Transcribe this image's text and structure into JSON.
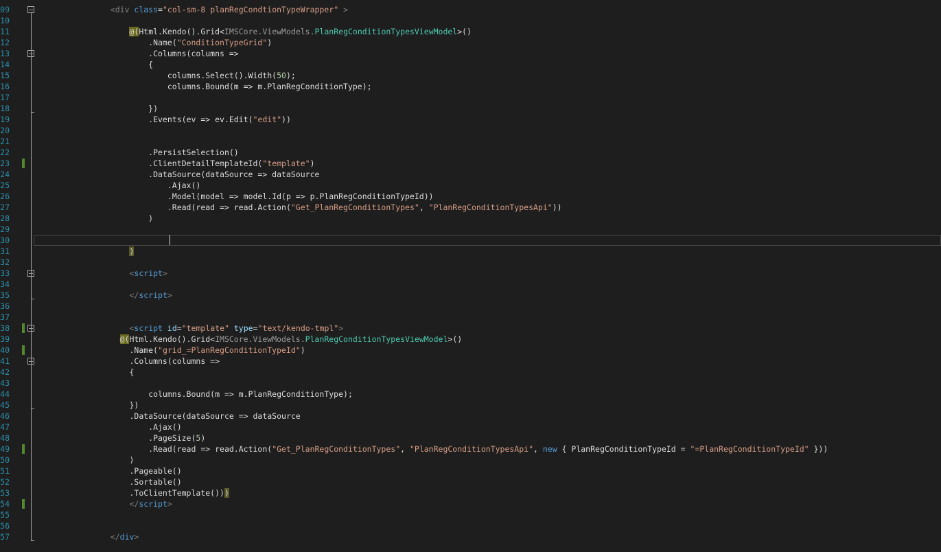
{
  "editor": {
    "colors": {
      "background": "#1e1e1e",
      "line_number": "#2b91af",
      "change_marker": "#52892e",
      "string": "#d69d85",
      "type": "#4ec9b0",
      "keyword": "#569cd6",
      "tag": "#808080"
    },
    "caret_line": "30",
    "lines": [
      {
        "n": "09",
        "fold": true,
        "tokens": [
          [
            "t",
            "                <div "
          ],
          [
            "kw",
            "class"
          ],
          [
            "p",
            "="
          ],
          [
            "s",
            "\"col-sm-8 planRegCondtionTypeWrapper\""
          ],
          [
            "t",
            " >"
          ]
        ]
      },
      {
        "n": "10",
        "tokens": []
      },
      {
        "n": "11",
        "tokens": [
          [
            "p",
            "                    "
          ],
          [
            "ref",
            "@("
          ],
          [
            "p",
            "Html.Kendo().Grid<"
          ],
          [
            "ns",
            "IMSCore.ViewModels."
          ],
          [
            "ty",
            "PlanRegConditionTypesViewModel"
          ],
          [
            "p",
            ">()"
          ]
        ]
      },
      {
        "n": "12",
        "tokens": [
          [
            "p",
            "                        .Name("
          ],
          [
            "s",
            "\"ConditionTypeGrid\""
          ],
          [
            "p",
            ")"
          ]
        ]
      },
      {
        "n": "13",
        "fold": true,
        "tokens": [
          [
            "p",
            "                        .Columns(columns =>"
          ]
        ]
      },
      {
        "n": "14",
        "tokens": [
          [
            "p",
            "                        {"
          ]
        ]
      },
      {
        "n": "15",
        "tokens": [
          [
            "p",
            "                            columns.Select().Width("
          ],
          [
            "num",
            "50"
          ],
          [
            "p",
            ");"
          ]
        ]
      },
      {
        "n": "16",
        "tokens": [
          [
            "p",
            "                            columns.Bound(m => m.PlanRegConditionType);"
          ]
        ]
      },
      {
        "n": "17",
        "tokens": []
      },
      {
        "n": "18",
        "tokens": [
          [
            "p",
            "                        })"
          ]
        ]
      },
      {
        "n": "19",
        "tokens": [
          [
            "p",
            "                        .Events(ev => ev.Edit("
          ],
          [
            "s",
            "\"edit\""
          ],
          [
            "p",
            "))"
          ]
        ]
      },
      {
        "n": "20",
        "tokens": []
      },
      {
        "n": "21",
        "tokens": []
      },
      {
        "n": "22",
        "tokens": [
          [
            "p",
            "                        .PersistSelection()"
          ]
        ]
      },
      {
        "n": "23",
        "chg": true,
        "tokens": [
          [
            "p",
            "                        .ClientDetailTemplateId("
          ],
          [
            "s",
            "\"template\""
          ],
          [
            "p",
            ")"
          ]
        ]
      },
      {
        "n": "24",
        "tokens": [
          [
            "p",
            "                        .DataSource(dataSource => dataSource"
          ]
        ]
      },
      {
        "n": "25",
        "tokens": [
          [
            "p",
            "                            .Ajax()"
          ]
        ]
      },
      {
        "n": "26",
        "tokens": [
          [
            "p",
            "                            .Model(model => model.Id(p => p.PlanRegConditionTypeId))"
          ]
        ]
      },
      {
        "n": "27",
        "tokens": [
          [
            "p",
            "                            .Read(read => read.Action("
          ],
          [
            "s",
            "\"Get_PlanRegConditionTypes\""
          ],
          [
            "p",
            ", "
          ],
          [
            "s",
            "\"PlanRegConditionTypesApi\""
          ],
          [
            "p",
            "))"
          ]
        ]
      },
      {
        "n": "28",
        "tokens": [
          [
            "p",
            "                        )"
          ]
        ]
      },
      {
        "n": "29",
        "tokens": []
      },
      {
        "n": "30",
        "tokens": []
      },
      {
        "n": "31",
        "tokens": [
          [
            "p",
            "                    "
          ],
          [
            "brk",
            ")"
          ]
        ]
      },
      {
        "n": "32",
        "tokens": []
      },
      {
        "n": "33",
        "fold": true,
        "tokens": [
          [
            "p",
            "                    "
          ],
          [
            "t",
            "<"
          ],
          [
            "kw",
            "script"
          ],
          [
            "t",
            ">"
          ]
        ]
      },
      {
        "n": "34",
        "tokens": []
      },
      {
        "n": "35",
        "tokens": [
          [
            "p",
            "                    "
          ],
          [
            "t",
            "</"
          ],
          [
            "kw",
            "script"
          ],
          [
            "t",
            ">"
          ]
        ]
      },
      {
        "n": "36",
        "tokens": []
      },
      {
        "n": "37",
        "tokens": []
      },
      {
        "n": "38",
        "chg": true,
        "fold": true,
        "tokens": [
          [
            "p",
            "                    "
          ],
          [
            "t",
            "<"
          ],
          [
            "kw",
            "script "
          ],
          [
            "at",
            "id"
          ],
          [
            "p",
            "="
          ],
          [
            "s",
            "\"template\""
          ],
          [
            "p",
            " "
          ],
          [
            "at",
            "type"
          ],
          [
            "p",
            "="
          ],
          [
            "s",
            "\"text/kendo-tmpl\""
          ],
          [
            "t",
            ">"
          ]
        ]
      },
      {
        "n": "39",
        "tokens": [
          [
            "p",
            "                  "
          ],
          [
            "ref",
            "@("
          ],
          [
            "p",
            "Html.Kendo().Grid<"
          ],
          [
            "ns",
            "IMSCore.ViewModels."
          ],
          [
            "ty",
            "PlanRegConditionTypesViewModel"
          ],
          [
            "p",
            ">()"
          ]
        ]
      },
      {
        "n": "40",
        "chg": true,
        "tokens": [
          [
            "p",
            "                    .Name("
          ],
          [
            "s",
            "\"grid_=PlanRegConditionTypeId\""
          ],
          [
            "p",
            ")"
          ]
        ]
      },
      {
        "n": "41",
        "fold": true,
        "tokens": [
          [
            "p",
            "                    .Columns(columns =>"
          ]
        ]
      },
      {
        "n": "42",
        "tokens": [
          [
            "p",
            "                    {"
          ]
        ]
      },
      {
        "n": "43",
        "tokens": []
      },
      {
        "n": "44",
        "tokens": [
          [
            "p",
            "                        columns.Bound(m => m.PlanRegConditionType);"
          ]
        ]
      },
      {
        "n": "45",
        "tokens": [
          [
            "p",
            "                    })"
          ]
        ]
      },
      {
        "n": "46",
        "tokens": [
          [
            "p",
            "                    .DataSource(dataSource => dataSource"
          ]
        ]
      },
      {
        "n": "47",
        "tokens": [
          [
            "p",
            "                        .Ajax()"
          ]
        ]
      },
      {
        "n": "48",
        "tokens": [
          [
            "p",
            "                        .PageSize("
          ],
          [
            "num",
            "5"
          ],
          [
            "p",
            ")"
          ]
        ]
      },
      {
        "n": "49",
        "chg": true,
        "tokens": [
          [
            "p",
            "                        .Read(read => read.Action("
          ],
          [
            "s",
            "\"Get_PlanRegConditionTypes\""
          ],
          [
            "p",
            ", "
          ],
          [
            "s",
            "\"PlanRegConditionTypesApi\""
          ],
          [
            "p",
            ", "
          ],
          [
            "kw",
            "new"
          ],
          [
            "p",
            " { PlanRegConditionTypeId = "
          ],
          [
            "s",
            "\"=PlanRegConditionTypeId\""
          ],
          [
            "p",
            " }))"
          ]
        ]
      },
      {
        "n": "50",
        "tokens": [
          [
            "p",
            "                    )"
          ]
        ]
      },
      {
        "n": "51",
        "tokens": [
          [
            "p",
            "                    .Pageable()"
          ]
        ]
      },
      {
        "n": "52",
        "tokens": [
          [
            "p",
            "                    .Sortable()"
          ]
        ]
      },
      {
        "n": "53",
        "tokens": [
          [
            "p",
            "                    .ToClientTemplate())"
          ],
          [
            "brk",
            ")"
          ]
        ]
      },
      {
        "n": "54",
        "chg": true,
        "tokens": [
          [
            "p",
            "                    "
          ],
          [
            "t",
            "</"
          ],
          [
            "kw",
            "script"
          ],
          [
            "t",
            ">"
          ]
        ]
      },
      {
        "n": "55",
        "tokens": []
      },
      {
        "n": "56",
        "tokens": []
      },
      {
        "n": "57",
        "tokens": [
          [
            "p",
            "                "
          ],
          [
            "t",
            "</"
          ],
          [
            "kw",
            "div"
          ],
          [
            "t",
            ">"
          ]
        ]
      }
    ]
  }
}
